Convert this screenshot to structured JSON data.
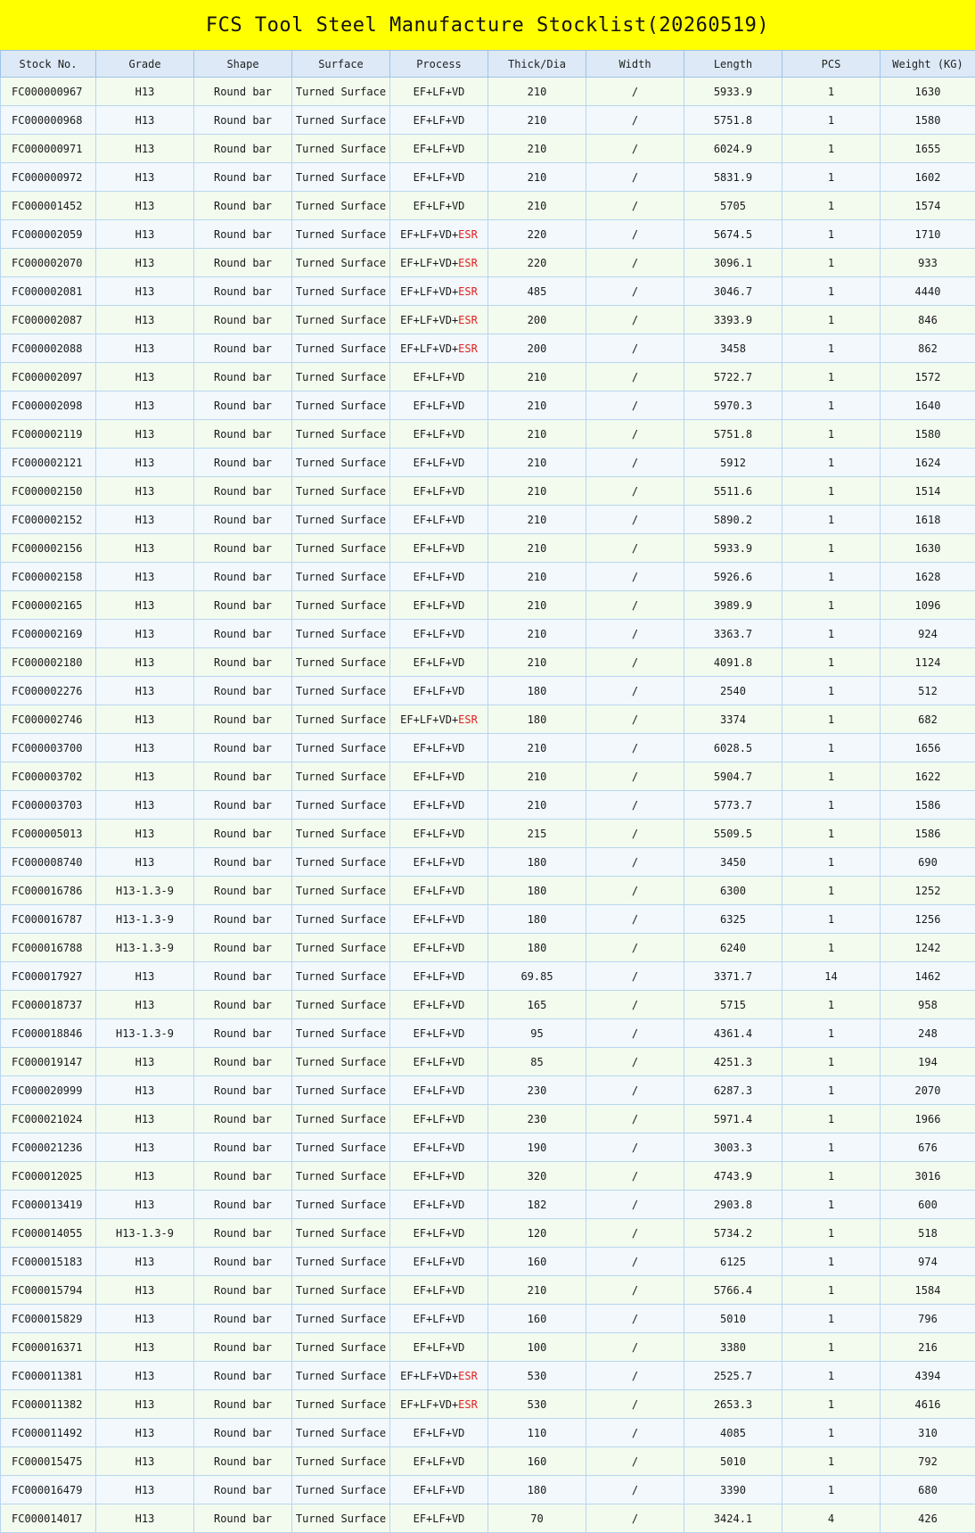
{
  "title": "FCS Tool Steel Manufacture Stocklist(20260519)",
  "columns": [
    "Stock No.",
    "Grade",
    "Shape",
    "Surface",
    "Process",
    "Thick/Dia",
    "Width",
    "Length",
    "PCS",
    "Weight (KG)"
  ],
  "colors": {
    "title_bg": "#ffff00",
    "header_bg": "#dde9f6",
    "row_odd": "#f3faee",
    "row_even": "#f2f8fc",
    "esr": "#e02020"
  },
  "rows": [
    [
      "FC000000967",
      "H13",
      "Round bar",
      "Turned Surface",
      "EF+LF+VD",
      "210",
      "/",
      "5933.9",
      "1",
      "1630"
    ],
    [
      "FC000000968",
      "H13",
      "Round bar",
      "Turned Surface",
      "EF+LF+VD",
      "210",
      "/",
      "5751.8",
      "1",
      "1580"
    ],
    [
      "FC000000971",
      "H13",
      "Round bar",
      "Turned Surface",
      "EF+LF+VD",
      "210",
      "/",
      "6024.9",
      "1",
      "1655"
    ],
    [
      "FC000000972",
      "H13",
      "Round bar",
      "Turned Surface",
      "EF+LF+VD",
      "210",
      "/",
      "5831.9",
      "1",
      "1602"
    ],
    [
      "FC000001452",
      "H13",
      "Round bar",
      "Turned Surface",
      "EF+LF+VD",
      "210",
      "/",
      "5705",
      "1",
      "1574"
    ],
    [
      "FC000002059",
      "H13",
      "Round bar",
      "Turned Surface",
      "EF+LF+VD+ESR",
      "220",
      "/",
      "5674.5",
      "1",
      "1710"
    ],
    [
      "FC000002070",
      "H13",
      "Round bar",
      "Turned Surface",
      "EF+LF+VD+ESR",
      "220",
      "/",
      "3096.1",
      "1",
      "933"
    ],
    [
      "FC000002081",
      "H13",
      "Round bar",
      "Turned Surface",
      "EF+LF+VD+ESR",
      "485",
      "/",
      "3046.7",
      "1",
      "4440"
    ],
    [
      "FC000002087",
      "H13",
      "Round bar",
      "Turned Surface",
      "EF+LF+VD+ESR",
      "200",
      "/",
      "3393.9",
      "1",
      "846"
    ],
    [
      "FC000002088",
      "H13",
      "Round bar",
      "Turned Surface",
      "EF+LF+VD+ESR",
      "200",
      "/",
      "3458",
      "1",
      "862"
    ],
    [
      "FC000002097",
      "H13",
      "Round bar",
      "Turned Surface",
      "EF+LF+VD",
      "210",
      "/",
      "5722.7",
      "1",
      "1572"
    ],
    [
      "FC000002098",
      "H13",
      "Round bar",
      "Turned Surface",
      "EF+LF+VD",
      "210",
      "/",
      "5970.3",
      "1",
      "1640"
    ],
    [
      "FC000002119",
      "H13",
      "Round bar",
      "Turned Surface",
      "EF+LF+VD",
      "210",
      "/",
      "5751.8",
      "1",
      "1580"
    ],
    [
      "FC000002121",
      "H13",
      "Round bar",
      "Turned Surface",
      "EF+LF+VD",
      "210",
      "/",
      "5912",
      "1",
      "1624"
    ],
    [
      "FC000002150",
      "H13",
      "Round bar",
      "Turned Surface",
      "EF+LF+VD",
      "210",
      "/",
      "5511.6",
      "1",
      "1514"
    ],
    [
      "FC000002152",
      "H13",
      "Round bar",
      "Turned Surface",
      "EF+LF+VD",
      "210",
      "/",
      "5890.2",
      "1",
      "1618"
    ],
    [
      "FC000002156",
      "H13",
      "Round bar",
      "Turned Surface",
      "EF+LF+VD",
      "210",
      "/",
      "5933.9",
      "1",
      "1630"
    ],
    [
      "FC000002158",
      "H13",
      "Round bar",
      "Turned Surface",
      "EF+LF+VD",
      "210",
      "/",
      "5926.6",
      "1",
      "1628"
    ],
    [
      "FC000002165",
      "H13",
      "Round bar",
      "Turned Surface",
      "EF+LF+VD",
      "210",
      "/",
      "3989.9",
      "1",
      "1096"
    ],
    [
      "FC000002169",
      "H13",
      "Round bar",
      "Turned Surface",
      "EF+LF+VD",
      "210",
      "/",
      "3363.7",
      "1",
      "924"
    ],
    [
      "FC000002180",
      "H13",
      "Round bar",
      "Turned Surface",
      "EF+LF+VD",
      "210",
      "/",
      "4091.8",
      "1",
      "1124"
    ],
    [
      "FC000002276",
      "H13",
      "Round bar",
      "Turned Surface",
      "EF+LF+VD",
      "180",
      "/",
      "2540",
      "1",
      "512"
    ],
    [
      "FC000002746",
      "H13",
      "Round bar",
      "Turned Surface",
      "EF+LF+VD+ESR",
      "180",
      "/",
      "3374",
      "1",
      "682"
    ],
    [
      "FC000003700",
      "H13",
      "Round bar",
      "Turned Surface",
      "EF+LF+VD",
      "210",
      "/",
      "6028.5",
      "1",
      "1656"
    ],
    [
      "FC000003702",
      "H13",
      "Round bar",
      "Turned Surface",
      "EF+LF+VD",
      "210",
      "/",
      "5904.7",
      "1",
      "1622"
    ],
    [
      "FC000003703",
      "H13",
      "Round bar",
      "Turned Surface",
      "EF+LF+VD",
      "210",
      "/",
      "5773.7",
      "1",
      "1586"
    ],
    [
      "FC000005013",
      "H13",
      "Round bar",
      "Turned Surface",
      "EF+LF+VD",
      "215",
      "/",
      "5509.5",
      "1",
      "1586"
    ],
    [
      "FC000008740",
      "H13",
      "Round bar",
      "Turned Surface",
      "EF+LF+VD",
      "180",
      "/",
      "3450",
      "1",
      "690"
    ],
    [
      "FC000016786",
      "H13-1.3-9",
      "Round bar",
      "Turned Surface",
      "EF+LF+VD",
      "180",
      "/",
      "6300",
      "1",
      "1252"
    ],
    [
      "FC000016787",
      "H13-1.3-9",
      "Round bar",
      "Turned Surface",
      "EF+LF+VD",
      "180",
      "/",
      "6325",
      "1",
      "1256"
    ],
    [
      "FC000016788",
      "H13-1.3-9",
      "Round bar",
      "Turned Surface",
      "EF+LF+VD",
      "180",
      "/",
      "6240",
      "1",
      "1242"
    ],
    [
      "FC000017927",
      "H13",
      "Round bar",
      "Turned Surface",
      "EF+LF+VD",
      "69.85",
      "/",
      "3371.7",
      "14",
      "1462"
    ],
    [
      "FC000018737",
      "H13",
      "Round bar",
      "Turned Surface",
      "EF+LF+VD",
      "165",
      "/",
      "5715",
      "1",
      "958"
    ],
    [
      "FC000018846",
      "H13-1.3-9",
      "Round bar",
      "Turned Surface",
      "EF+LF+VD",
      "95",
      "/",
      "4361.4",
      "1",
      "248"
    ],
    [
      "FC000019147",
      "H13",
      "Round bar",
      "Turned Surface",
      "EF+LF+VD",
      "85",
      "/",
      "4251.3",
      "1",
      "194"
    ],
    [
      "FC000020999",
      "H13",
      "Round bar",
      "Turned Surface",
      "EF+LF+VD",
      "230",
      "/",
      "6287.3",
      "1",
      "2070"
    ],
    [
      "FC000021024",
      "H13",
      "Round bar",
      "Turned Surface",
      "EF+LF+VD",
      "230",
      "/",
      "5971.4",
      "1",
      "1966"
    ],
    [
      "FC000021236",
      "H13",
      "Round bar",
      "Turned Surface",
      "EF+LF+VD",
      "190",
      "/",
      "3003.3",
      "1",
      "676"
    ],
    [
      "FC000012025",
      "H13",
      "Round bar",
      "Turned Surface",
      "EF+LF+VD",
      "320",
      "/",
      "4743.9",
      "1",
      "3016"
    ],
    [
      "FC000013419",
      "H13",
      "Round bar",
      "Turned Surface",
      "EF+LF+VD",
      "182",
      "/",
      "2903.8",
      "1",
      "600"
    ],
    [
      "FC000014055",
      "H13-1.3-9",
      "Round bar",
      "Turned Surface",
      "EF+LF+VD",
      "120",
      "/",
      "5734.2",
      "1",
      "518"
    ],
    [
      "FC000015183",
      "H13",
      "Round bar",
      "Turned Surface",
      "EF+LF+VD",
      "160",
      "/",
      "6125",
      "1",
      "974"
    ],
    [
      "FC000015794",
      "H13",
      "Round bar",
      "Turned Surface",
      "EF+LF+VD",
      "210",
      "/",
      "5766.4",
      "1",
      "1584"
    ],
    [
      "FC000015829",
      "H13",
      "Round bar",
      "Turned Surface",
      "EF+LF+VD",
      "160",
      "/",
      "5010",
      "1",
      "796"
    ],
    [
      "FC000016371",
      "H13",
      "Round bar",
      "Turned Surface",
      "EF+LF+VD",
      "100",
      "/",
      "3380",
      "1",
      "216"
    ],
    [
      "FC000011381",
      "H13",
      "Round bar",
      "Turned Surface",
      "EF+LF+VD+ESR",
      "530",
      "/",
      "2525.7",
      "1",
      "4394"
    ],
    [
      "FC000011382",
      "H13",
      "Round bar",
      "Turned Surface",
      "EF+LF+VD+ESR",
      "530",
      "/",
      "2653.3",
      "1",
      "4616"
    ],
    [
      "FC000011492",
      "H13",
      "Round bar",
      "Turned Surface",
      "EF+LF+VD",
      "110",
      "/",
      "4085",
      "1",
      "310"
    ],
    [
      "FC000015475",
      "H13",
      "Round bar",
      "Turned Surface",
      "EF+LF+VD",
      "160",
      "/",
      "5010",
      "1",
      "792"
    ],
    [
      "FC000016479",
      "H13",
      "Round bar",
      "Turned Surface",
      "EF+LF+VD",
      "180",
      "/",
      "3390",
      "1",
      "680"
    ],
    [
      "FC000014017",
      "H13",
      "Round bar",
      "Turned Surface",
      "EF+LF+VD",
      "70",
      "/",
      "3424.1",
      "4",
      "426"
    ]
  ]
}
